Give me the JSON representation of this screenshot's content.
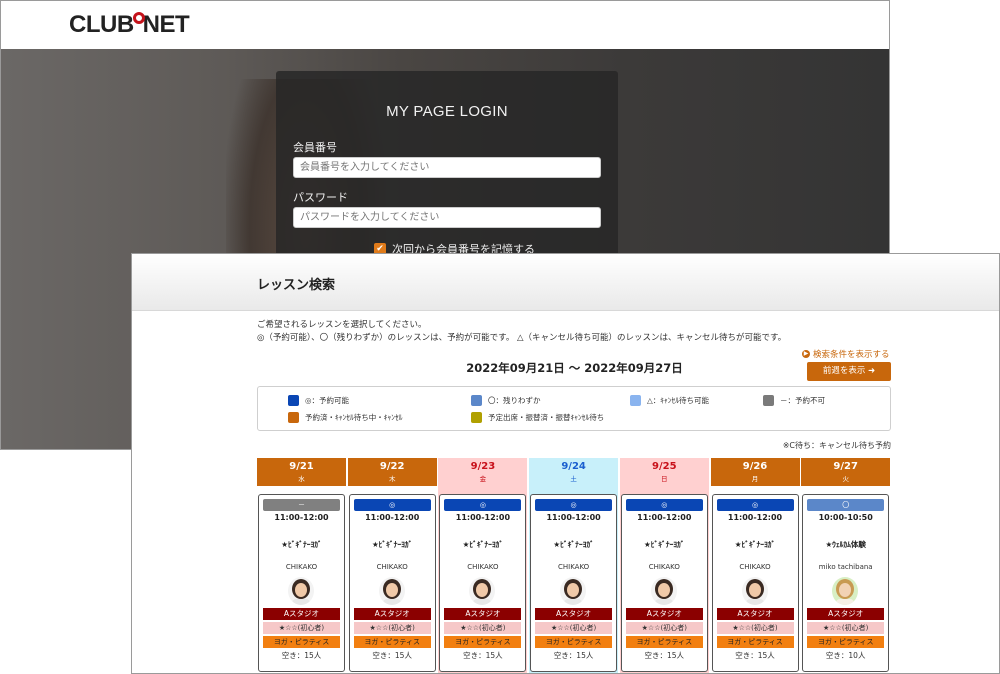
{
  "login": {
    "logo": "CLUB NET",
    "title": "MY PAGE LOGIN",
    "member_label": "会員番号",
    "member_placeholder": "会員番号を入力してください",
    "password_label": "パスワード",
    "password_placeholder": "パスワードを入力してください",
    "remember_label": "次回から会員番号を記憶する"
  },
  "lesson": {
    "title": "レッスン検索",
    "instruction_1": "ご希望されるレッスンを選択してください。",
    "instruction_2": "◎（予約可能）、〇（残りわずか）のレッスンは、予約が可能です。 △（キャンセル待ち可能）のレッスンは、キャンセル待ちが可能です。",
    "show_conditions": "検索条件を表示する",
    "date_range": "2022年09月21日 〜 2022年09月27日",
    "prev_week": "前週を表示 ➜",
    "legend": [
      {
        "label": "◎：予約可能",
        "color": "#0a46b4"
      },
      {
        "label": "〇：残りわずか",
        "color": "#5b87c9"
      },
      {
        "label": "△：ｷｬﾝｾﾙ待ち可能",
        "color": "#8ab4ef"
      },
      {
        "label": "－：予約不可",
        "color": "#7a7a7a"
      },
      {
        "label": "予約済・ｷｬﾝｾﾙ待ち中・ｷｬﾝｾﾙ",
        "color": "#c8670c"
      },
      {
        "label": "予定出席・振替済・振替ｷｬﾝｾﾙ待ち",
        "color": "#b0a000"
      }
    ],
    "cwait_note": "※C待ち：キャンセル待ち予約",
    "days": [
      {
        "date": "9/21",
        "weekday": "水",
        "head_color": "#c8670c",
        "bg": "#ffffff",
        "badge": "－",
        "badge_color": "#808080",
        "time": "11:00-12:00",
        "name": "★ﾋﾞｷﾞﾅｰﾖｶﾞ",
        "instructor": "CHIKAKO",
        "studio": "Aスタジオ",
        "level": "★☆☆(初心者)",
        "category": "ヨガ・ピラティス",
        "vacancy": "空き：15人"
      },
      {
        "date": "9/22",
        "weekday": "木",
        "head_color": "#c8670c",
        "bg": "#ffffff",
        "badge": "◎",
        "badge_color": "#0a46b4",
        "time": "11:00-12:00",
        "name": "★ﾋﾞｷﾞﾅｰﾖｶﾞ",
        "instructor": "CHIKAKO",
        "studio": "Aスタジオ",
        "level": "★☆☆(初心者)",
        "category": "ヨガ・ピラティス",
        "vacancy": "空き：15人"
      },
      {
        "date": "9/23",
        "weekday": "金",
        "head_color": "#ffd0d0",
        "bg": "#ffd0d0",
        "badge": "◎",
        "badge_color": "#0a46b4",
        "time": "11:00-12:00",
        "name": "★ﾋﾞｷﾞﾅｰﾖｶﾞ",
        "instructor": "CHIKAKO",
        "studio": "Aスタジオ",
        "level": "★☆☆(初心者)",
        "category": "ヨガ・ピラティス",
        "vacancy": "空き：15人"
      },
      {
        "date": "9/24",
        "weekday": "土",
        "head_color": "#c8f0fa",
        "bg": "#c8f0fa",
        "badge": "◎",
        "badge_color": "#0a46b4",
        "time": "11:00-12:00",
        "name": "★ﾋﾞｷﾞﾅｰﾖｶﾞ",
        "instructor": "CHIKAKO",
        "studio": "Aスタジオ",
        "level": "★☆☆(初心者)",
        "category": "ヨガ・ピラティス",
        "vacancy": "空き：15人"
      },
      {
        "date": "9/25",
        "weekday": "日",
        "head_color": "#ffd0d0",
        "bg": "#ffd0d0",
        "badge": "◎",
        "badge_color": "#0a46b4",
        "time": "11:00-12:00",
        "name": "★ﾋﾞｷﾞﾅｰﾖｶﾞ",
        "instructor": "CHIKAKO",
        "studio": "Aスタジオ",
        "level": "★☆☆(初心者)",
        "category": "ヨガ・ピラティス",
        "vacancy": "空き：15人"
      },
      {
        "date": "9/26",
        "weekday": "月",
        "head_color": "#c8670c",
        "bg": "#ffffff",
        "badge": "◎",
        "badge_color": "#0a46b4",
        "time": "11:00-12:00",
        "name": "★ﾋﾞｷﾞﾅｰﾖｶﾞ",
        "instructor": "CHIKAKO",
        "studio": "Aスタジオ",
        "level": "★☆☆(初心者)",
        "category": "ヨガ・ピラティス",
        "vacancy": "空き：15人"
      },
      {
        "date": "9/27",
        "weekday": "火",
        "head_color": "#c8670c",
        "bg": "#ffffff",
        "badge": "〇",
        "badge_color": "#5b87c9",
        "time": "10:00-10:50",
        "name": "★ｳｪﾙｶﾑ体験",
        "instructor": "miko tachibana",
        "studio": "Aスタジオ",
        "level": "★☆☆(初心者)",
        "category": "ヨガ・ピラティス",
        "vacancy": "空き：10人"
      }
    ]
  }
}
